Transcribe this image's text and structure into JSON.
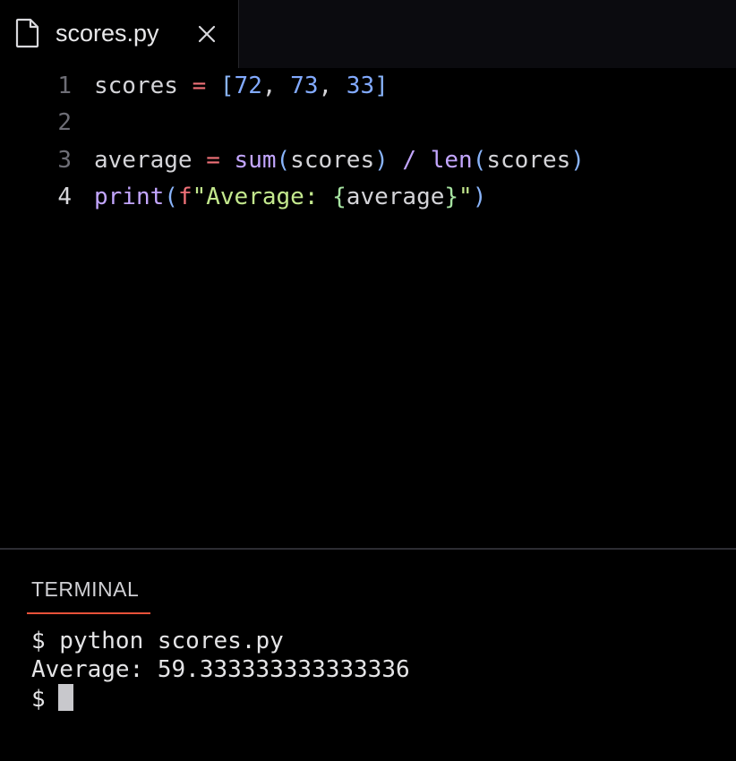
{
  "tab": {
    "icon": "file-icon",
    "title": "scores.py",
    "close_icon": "close-icon"
  },
  "editor": {
    "lines": [
      {
        "number": "1",
        "tokens": [
          {
            "t": "scores",
            "k": "ident"
          },
          {
            "t": " ",
            "k": "ident"
          },
          {
            "t": "=",
            "k": "op"
          },
          {
            "t": " ",
            "k": "ident"
          },
          {
            "t": "[",
            "k": "brk"
          },
          {
            "t": "72",
            "k": "num"
          },
          {
            "t": ", ",
            "k": "ident"
          },
          {
            "t": "73",
            "k": "num"
          },
          {
            "t": ", ",
            "k": "ident"
          },
          {
            "t": "33",
            "k": "num"
          },
          {
            "t": "]",
            "k": "brk"
          }
        ]
      },
      {
        "number": "2",
        "tokens": []
      },
      {
        "number": "3",
        "tokens": [
          {
            "t": "average",
            "k": "ident"
          },
          {
            "t": " ",
            "k": "ident"
          },
          {
            "t": "=",
            "k": "op"
          },
          {
            "t": " ",
            "k": "ident"
          },
          {
            "t": "sum",
            "k": "fn"
          },
          {
            "t": "(",
            "k": "brk"
          },
          {
            "t": "scores",
            "k": "ident"
          },
          {
            "t": ")",
            "k": "brk"
          },
          {
            "t": " ",
            "k": "ident"
          },
          {
            "t": "/",
            "k": "fn"
          },
          {
            "t": " ",
            "k": "ident"
          },
          {
            "t": "len",
            "k": "fn"
          },
          {
            "t": "(",
            "k": "brk"
          },
          {
            "t": "scores",
            "k": "ident"
          },
          {
            "t": ")",
            "k": "brk"
          }
        ]
      },
      {
        "number": "4",
        "active": true,
        "tokens": [
          {
            "t": "print",
            "k": "fn"
          },
          {
            "t": "(",
            "k": "brk"
          },
          {
            "t": "f",
            "k": "fpre"
          },
          {
            "t": "\"Average: ",
            "k": "strk"
          },
          {
            "t": "{",
            "k": "brace"
          },
          {
            "t": "average",
            "k": "ident"
          },
          {
            "t": "}",
            "k": "brace"
          },
          {
            "t": "\"",
            "k": "strk"
          },
          {
            "t": ")",
            "k": "brk"
          }
        ]
      }
    ]
  },
  "terminal": {
    "tab_label": "TERMINAL",
    "accent": "#e8523a",
    "lines": [
      "$ python scores.py",
      "Average: 59.333333333333336",
      "$"
    ]
  }
}
